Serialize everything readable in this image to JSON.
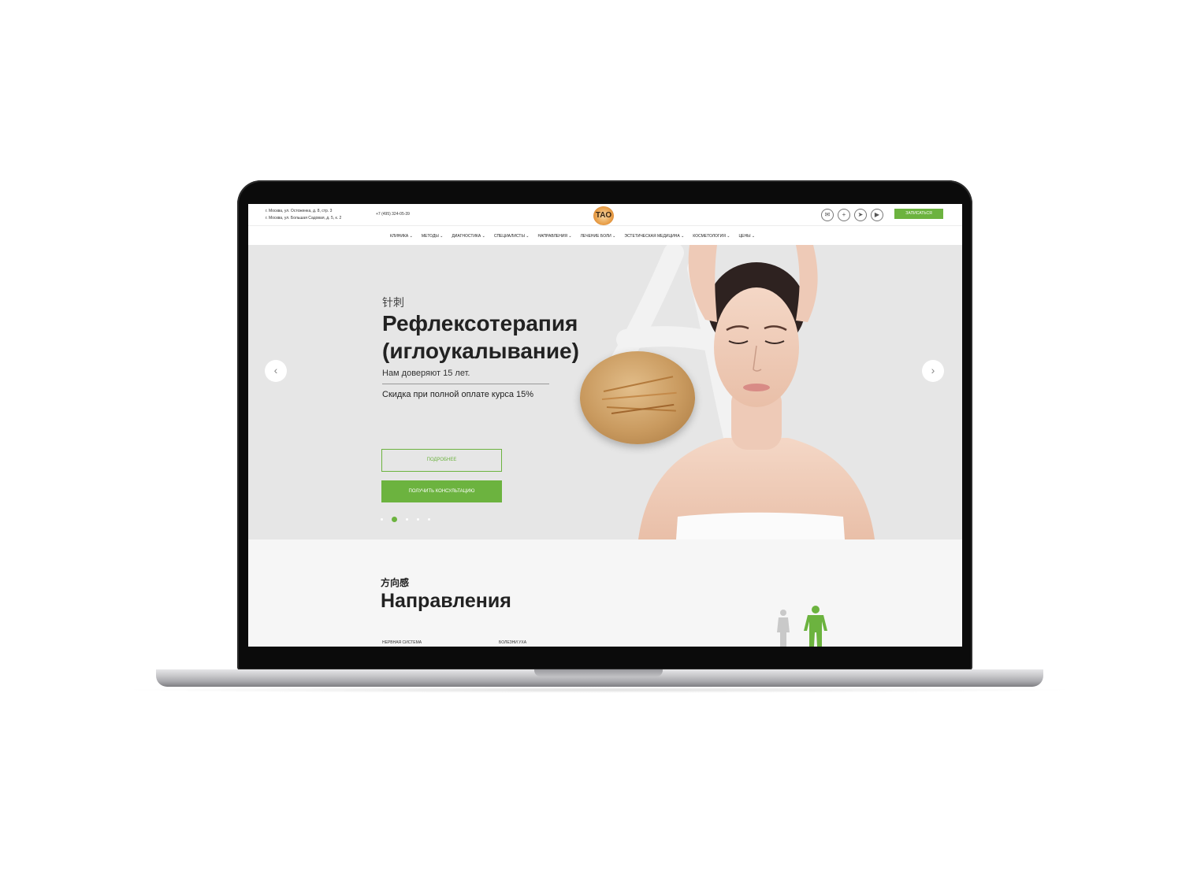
{
  "header": {
    "addresses": [
      "г. Москва, ул. Остоженка, д. 8, стр. 3",
      "г. Москва, ул. Большая Садовая, д. 5, к. 2"
    ],
    "phone": "+7 (495) 324-05-39",
    "logo_text": "ТАО",
    "social_icons": [
      "vk-icon",
      "plus-icon",
      "telegram-icon",
      "youtube-icon"
    ],
    "book_label": "ЗАПИСАТЬСЯ"
  },
  "nav": {
    "items": [
      "КЛИНИКА",
      "МЕТОДЫ",
      "ДИАГНОСТИКА",
      "СПЕЦИАЛИСТЫ",
      "НАПРАВЛЕНИЯ",
      "ЛЕЧЕНИЕ БОЛИ",
      "ЭСТЕТИЧЕСКАЯ МЕДИЦИНА",
      "КОСМЕТОЛОГИЯ",
      "ЦЕНЫ"
    ]
  },
  "hero": {
    "hanzi": "针刺",
    "title_line1": "Рефлексотерапия",
    "title_line2": "(иглоукалывание)",
    "subtitle": "Нам доверяют 15 лет.",
    "discount": "Скидка при полной оплате курса 15%",
    "more_label": "ПОДРОБНЕЕ",
    "consult_label": "ПОЛУЧИТЬ КОНСУЛЬТАЦИЮ",
    "slides_total": 5,
    "active_slide": 2
  },
  "directions": {
    "hanzi": "方向感",
    "title": "Направления",
    "categories": [
      "НЕРВНАЯ СИСТЕМА",
      "БОЛЕЗНИ УХА"
    ]
  },
  "colors": {
    "accent": "#6cb33f",
    "hero_bg": "#e6e6e6"
  }
}
